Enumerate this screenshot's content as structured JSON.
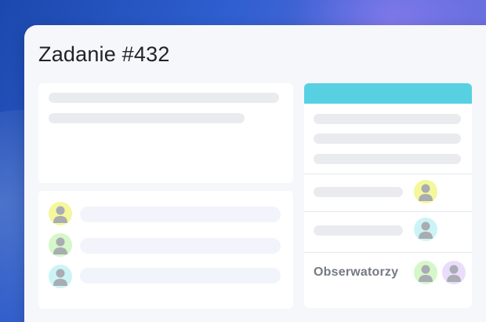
{
  "task": {
    "title": "Zadanie #432"
  },
  "sidebar": {
    "observers_label": "Obserwatorzy"
  },
  "avatars": {
    "assignee_1": {
      "icon": "user-avatar-icon",
      "color": "#f4f79a"
    },
    "assignee_2": {
      "icon": "user-avatar-icon",
      "color": "#d6f7c9"
    },
    "assignee_3": {
      "icon": "user-avatar-icon",
      "color": "#ccf4f6"
    },
    "right_1": {
      "icon": "user-avatar-icon",
      "color": "#f4f79a"
    },
    "right_2": {
      "icon": "user-avatar-icon",
      "color": "#ccf4f6"
    },
    "observer_1": {
      "icon": "user-avatar-icon",
      "color": "#d6f7c9"
    },
    "observer_2": {
      "icon": "user-avatar-icon",
      "color": "#e9ddfb"
    }
  },
  "colors": {
    "accent_button": "#bdf01f",
    "panel_header": "#57d1e2",
    "background_gradient_start": "#1b48ad",
    "background_gradient_end": "#8b7be6"
  },
  "icons": {
    "dropdown": "chevron-down-icon"
  }
}
